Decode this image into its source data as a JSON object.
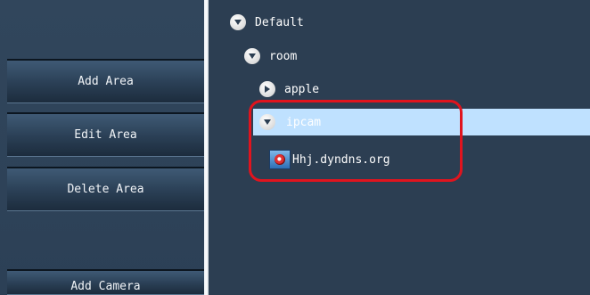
{
  "sidebar": {
    "buttons": [
      {
        "label": "Add Area"
      },
      {
        "label": "Edit Area"
      },
      {
        "label": "Delete Area"
      },
      {
        "label": "Add Camera"
      }
    ]
  },
  "tree": {
    "root": {
      "label": "Default",
      "expanded": true,
      "icon": "collapse-arrow-icon"
    },
    "area": {
      "label": "room",
      "expanded": true,
      "icon": "collapse-arrow-icon"
    },
    "sub_areas": [
      {
        "label": "apple",
        "expanded": false,
        "icon": "expand-arrow-icon"
      },
      {
        "label": "ipcam",
        "expanded": true,
        "selected": true,
        "icon": "collapse-arrow-icon"
      }
    ],
    "camera": {
      "label": "Hhj.dyndns.org",
      "icon": "camera-icon"
    }
  },
  "colors": {
    "background": "#2c3e52",
    "selection": "#bfe1ff",
    "highlight": "#e0141e"
  }
}
